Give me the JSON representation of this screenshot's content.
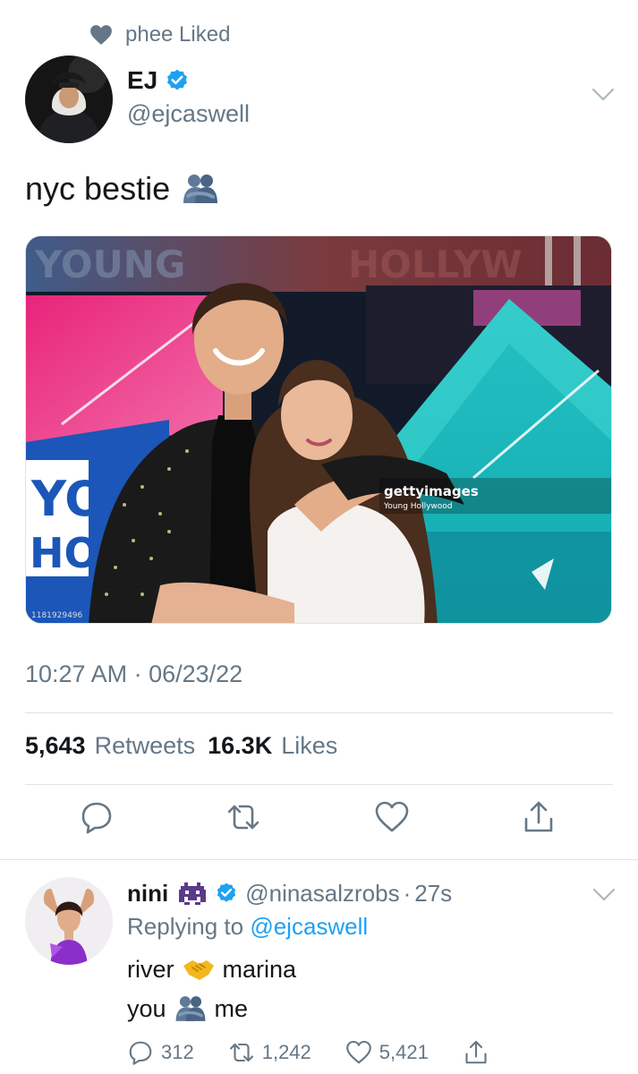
{
  "context": {
    "liked_text": "phee Liked"
  },
  "tweet": {
    "display_name": "EJ",
    "handle": "@ejcaswell",
    "text": "nyc bestie",
    "photo_watermark_brand": "gettyimages",
    "photo_watermark_credit": "Young Hollywood",
    "photo_id": "1181929496",
    "timestamp": "10:27 AM · 06/23/22",
    "retweets_count": "5,643",
    "retweets_label": "Retweets",
    "likes_count": "16.3K",
    "likes_label": "Likes"
  },
  "reply": {
    "display_name": "nini",
    "handle": "@ninasalzrobs",
    "time_sep": "·",
    "time": "27s",
    "replying_label": "Replying to",
    "replying_to": "@ejcaswell",
    "line1_left": "river",
    "line1_right": "marina",
    "line2_left": "you",
    "line2_right": "me",
    "replies": "312",
    "retweets": "1,242",
    "likes": "5,421"
  },
  "colors": {
    "accent": "#1da1f2",
    "muted": "#657786",
    "text": "#14171a",
    "border": "#dfe3e7"
  },
  "icons": [
    "heart-icon",
    "verified-badge-icon",
    "chevron-down-icon",
    "hug-emoji-icon",
    "reply-icon",
    "retweet-icon",
    "like-icon",
    "share-icon",
    "alien-monster-emoji-icon",
    "handshake-emoji-icon"
  ]
}
